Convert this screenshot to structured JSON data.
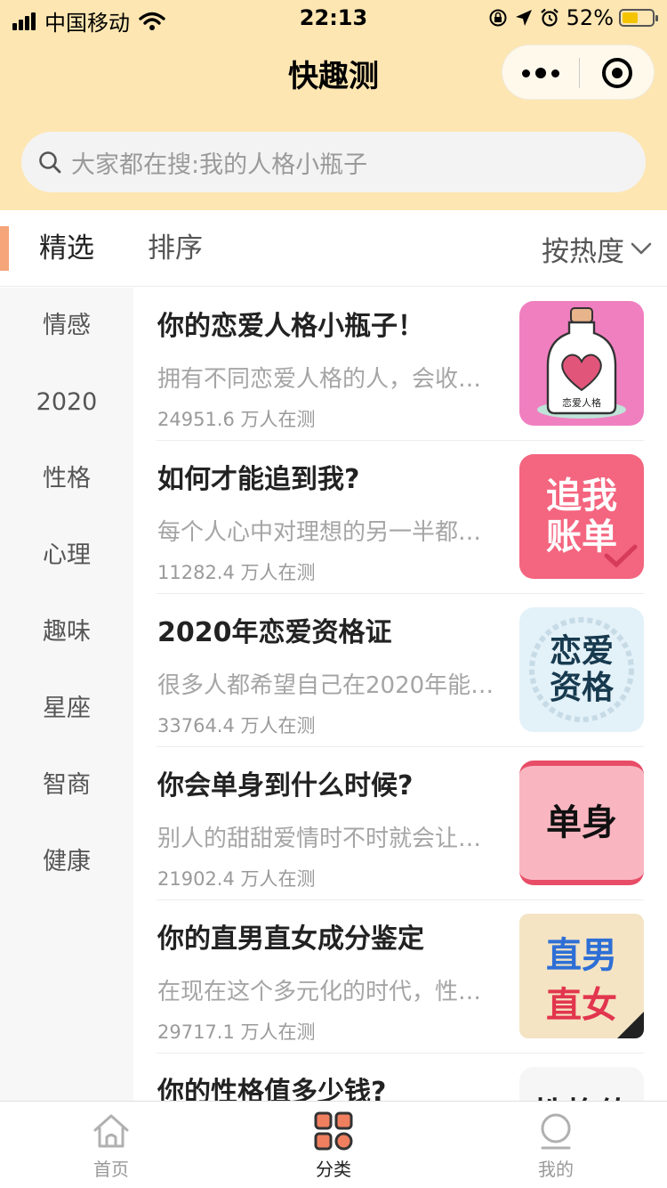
{
  "status_bar": {
    "carrier": "中国移动",
    "time": "22:13",
    "battery_percent": "52%",
    "battery_level": 0.52
  },
  "nav": {
    "title": "快趣测"
  },
  "search": {
    "placeholder": "大家都在搜:我的人格小瓶子"
  },
  "filter": {
    "selected": "精选",
    "sort_label": "排序",
    "order_label": "按热度"
  },
  "sidebar": {
    "items": [
      "情感",
      "2020",
      "性格",
      "心理",
      "趣味",
      "星座",
      "智商",
      "健康"
    ]
  },
  "list": {
    "items": [
      {
        "title": "你的恋爱人格小瓶子！",
        "desc": "拥有不同恋爱人格的人，会收…",
        "count": "24951.6 万人在测",
        "thumb_text": "恋爱人格",
        "thumb_icon": "heart-bottle-icon",
        "thumb_bg": "#f07fc0"
      },
      {
        "title": "如何才能追到我?",
        "desc": "每个人心中对理想的另一半都…",
        "count": "11282.4 万人在测",
        "thumb_text": "追我账单",
        "thumb_bg": "#f4657f"
      },
      {
        "title": "2020年恋爱资格证",
        "desc": "很多人都希望自己在2020年能…",
        "count": "33764.4 万人在测",
        "thumb_text": "恋爱资格",
        "thumb_bg": "#e3f1f8"
      },
      {
        "title": "你会单身到什么时候?",
        "desc": "别人的甜甜爱情时不时就会让…",
        "count": "21902.4 万人在测",
        "thumb_text": "单身",
        "thumb_bg": "#f9b6c1"
      },
      {
        "title": "你的直男直女成分鉴定",
        "desc": "在现在这个多元化的时代，性…",
        "count": "29717.1 万人在测",
        "thumb_text_1": "直男",
        "thumb_text_2": "直女",
        "thumb_bg": "#f4e4c4"
      },
      {
        "title": "你的性格值多少钱?",
        "thumb_text": "性格值",
        "thumb_bg": "#f6f6f6"
      }
    ]
  },
  "tabbar": {
    "items": [
      {
        "label": "首页",
        "icon": "home-icon"
      },
      {
        "label": "分类",
        "icon": "category-icon"
      },
      {
        "label": "我的",
        "icon": "profile-icon"
      }
    ],
    "active_index": 1
  },
  "colors": {
    "header_bg": "#fde6b2",
    "accent": "#f4a579",
    "category_icon": "#f07f5f"
  }
}
